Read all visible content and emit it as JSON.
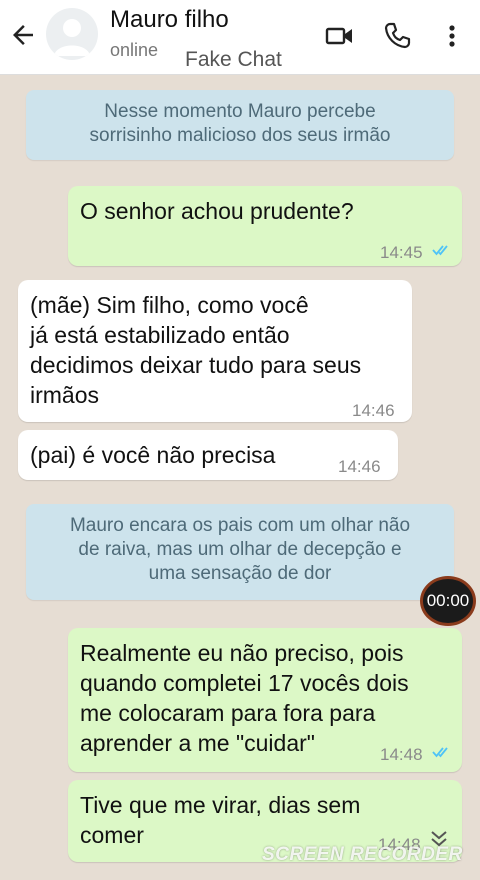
{
  "header": {
    "contact_name": "Mauro filho",
    "status": "online",
    "app_name": "Fake Chat",
    "icons": [
      "back-arrow-icon",
      "avatar",
      "video-call-icon",
      "phone-icon",
      "more-vert-icon"
    ]
  },
  "messages": [
    {
      "type": "system",
      "text": "Nesse momento Mauro percebe\nsorrisinho malicioso dos seus irmão"
    },
    {
      "type": "out",
      "text": "O senhor achou prudente?",
      "time": "14:45",
      "read": true
    },
    {
      "type": "in",
      "text": "(mãe) Sim filho, como você\njá está estabilizado então\ndecidimos deixar tudo para seus\nirmãos",
      "time": "14:46"
    },
    {
      "type": "in",
      "text": "(pai) é você não precisa",
      "time": "14:46"
    },
    {
      "type": "system",
      "text": "Mauro encara os pais com um olhar não\nde raiva, mas um olhar de decepção e\numa sensação de dor"
    },
    {
      "type": "out",
      "text": "Realmente eu não preciso, pois\nquando completei 17 vocês dois\nme colocaram para fora para\naprender  a me \"cuidar\"",
      "time": "14:48",
      "read": true
    },
    {
      "type": "out",
      "text": "Tive que me virar, dias sem\ncomer",
      "time": "14:48"
    }
  ],
  "overlay": {
    "timer": "00:00",
    "watermark": "SCREEN RECORDER"
  },
  "colors": {
    "outgoing_bubble": "#dcf8c6",
    "incoming_bubble": "#ffffff",
    "system_bubble": "#cde3ec",
    "read_ticks": "#4fc3f7",
    "chat_background": "#e6ddd3"
  }
}
